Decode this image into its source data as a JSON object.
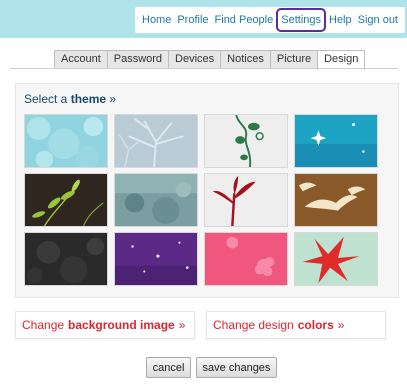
{
  "nav": {
    "items": [
      "Home",
      "Profile",
      "Find People",
      "Settings",
      "Help",
      "Sign out"
    ]
  },
  "tabs": [
    "Account",
    "Password",
    "Devices",
    "Notices",
    "Picture",
    "Design"
  ],
  "active_tab": "Design",
  "theme_panel": {
    "title_prefix": "Select a",
    "title_bold": "theme",
    "title_suffix": "»"
  },
  "links": {
    "background": {
      "prefix": "Change",
      "bold": "background image",
      "suffix": "»"
    },
    "colors": {
      "prefix": "Change design",
      "bold": "colors",
      "suffix": "»"
    }
  },
  "buttons": {
    "cancel": "cancel",
    "save": "save changes"
  },
  "colors": {
    "banner": "#aee3ea",
    "link": "#1d79a8",
    "accent_red": "#d8262e",
    "highlight": "#5a2ca0"
  }
}
